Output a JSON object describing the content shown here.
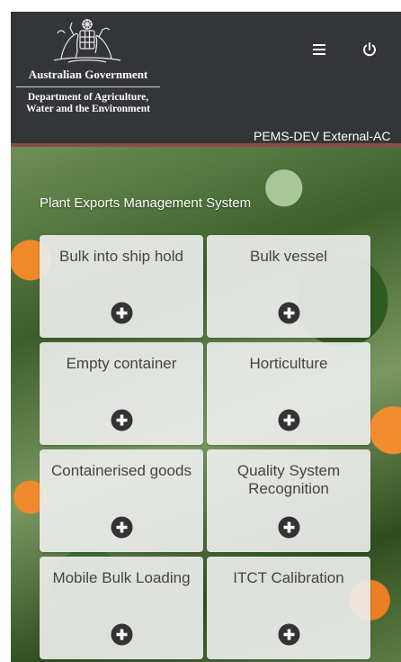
{
  "header": {
    "gov_name": "Australian Government",
    "dept_line1": "Department of Agriculture,",
    "dept_line2": "Water and the Environment",
    "environment_label": "PEMS-DEV External-AC",
    "menu_icon": "hamburger-menu-icon",
    "power_icon": "power-icon"
  },
  "main": {
    "system_title": "Plant Exports Management System",
    "tiles": [
      {
        "label": "Bulk into ship hold",
        "icon": "plus-circle-icon"
      },
      {
        "label": "Bulk vessel",
        "icon": "plus-circle-icon"
      },
      {
        "label": "Empty container",
        "icon": "plus-circle-icon"
      },
      {
        "label": "Horticulture",
        "icon": "plus-circle-icon"
      },
      {
        "label": "Containerised goods",
        "icon": "plus-circle-icon"
      },
      {
        "label": "Quality System Recognition",
        "icon": "plus-circle-icon"
      },
      {
        "label": "Mobile Bulk Loading",
        "icon": "plus-circle-icon"
      },
      {
        "label": "ITCT Calibration",
        "icon": "plus-circle-icon"
      }
    ]
  },
  "colors": {
    "header_bg": "#333538",
    "header_accent": "#8c4a4a",
    "tile_bg": "#f0f0f0",
    "tile_text": "#444444",
    "icon_dark": "#333333"
  }
}
